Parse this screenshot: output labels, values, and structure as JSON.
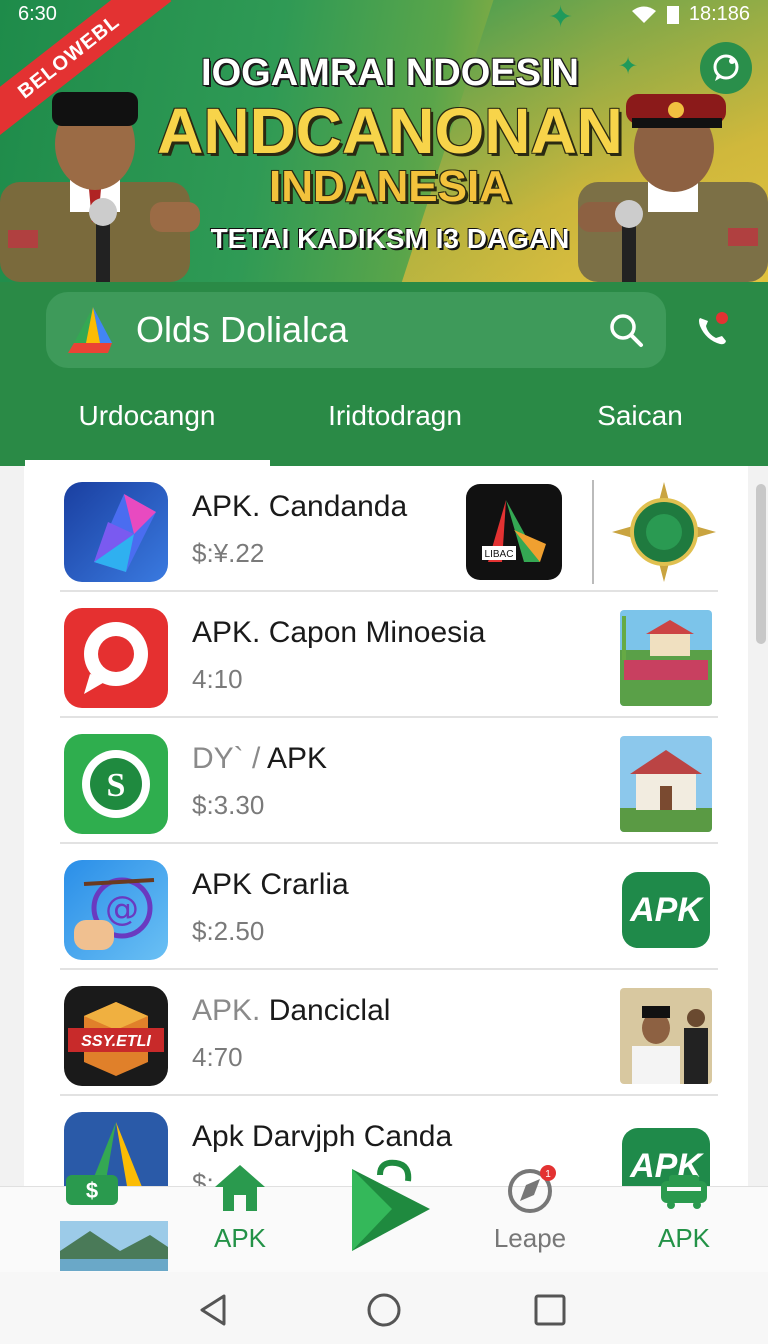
{
  "status": {
    "time": "6:30",
    "battery_text": "18:186"
  },
  "banner": {
    "ribbon": "BELOWEBL",
    "line1": "IOGAMRAI NDOESIN",
    "line2": "ANDCANONAN",
    "line3": "INDANESIA",
    "line4": "TETAI KADIKSM I3 DAGAN"
  },
  "search": {
    "text": "Olds Dolialca"
  },
  "tabs": [
    {
      "label": "Urdocangn"
    },
    {
      "label": "Iridtodragn"
    },
    {
      "label": "Saican"
    }
  ],
  "apps": [
    {
      "title": "APK. Candanda",
      "sub": "$:¥.22"
    },
    {
      "title_light": "",
      "title": "APK. Capon Minoesia",
      "sub": "4:10"
    },
    {
      "title_light": "DY` / ",
      "title": "APK",
      "sub": "$:3.30"
    },
    {
      "title": "APK Crarlia",
      "sub": "$:2.50",
      "badge": "APK"
    },
    {
      "title_light": "APK.",
      "title": " Danciclal",
      "sub": "4:70"
    },
    {
      "title": "Apk Darvjph Canda",
      "sub": "$:",
      "badge": "APK"
    }
  ],
  "icon_labels": {
    "shield": "SSY.ETLI",
    "a_logo": "LIBAC"
  },
  "bottom_nav": [
    {
      "label": "APK"
    },
    {
      "label": "Leape",
      "badge": "1"
    },
    {
      "label": "APK"
    }
  ],
  "colors": {
    "primary": "#2a8a46",
    "accent_yellow": "#f7d44a",
    "ribbon_red": "#e33232"
  }
}
